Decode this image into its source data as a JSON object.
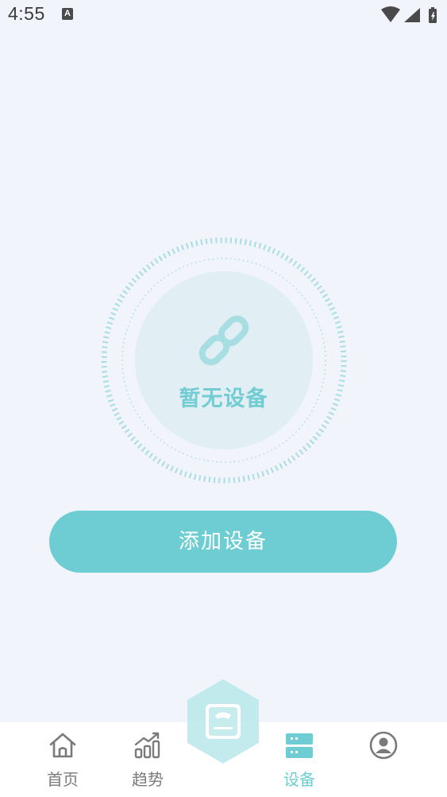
{
  "status_bar": {
    "time": "4:55",
    "notification_icon": "a-badge-icon",
    "icons": [
      "wifi-icon",
      "signal-icon",
      "battery-icon"
    ]
  },
  "empty_state": {
    "icon": "link-icon",
    "text": "暂无设备"
  },
  "add_button": {
    "label": "添加设备"
  },
  "tab_bar": {
    "tabs": [
      {
        "label": "首页",
        "icon": "home-icon",
        "active": false
      },
      {
        "label": "趋势",
        "icon": "trend-chart-icon",
        "active": false
      },
      {
        "label": "",
        "icon": "scale-icon",
        "active": false
      },
      {
        "label": "设备",
        "icon": "device-icon",
        "active": true
      },
      {
        "label": "",
        "icon": "profile-icon",
        "active": false
      }
    ]
  },
  "colors": {
    "accent": "#6dcdd2",
    "background": "#f1f4fb",
    "inactive": "#7a7a7a"
  }
}
